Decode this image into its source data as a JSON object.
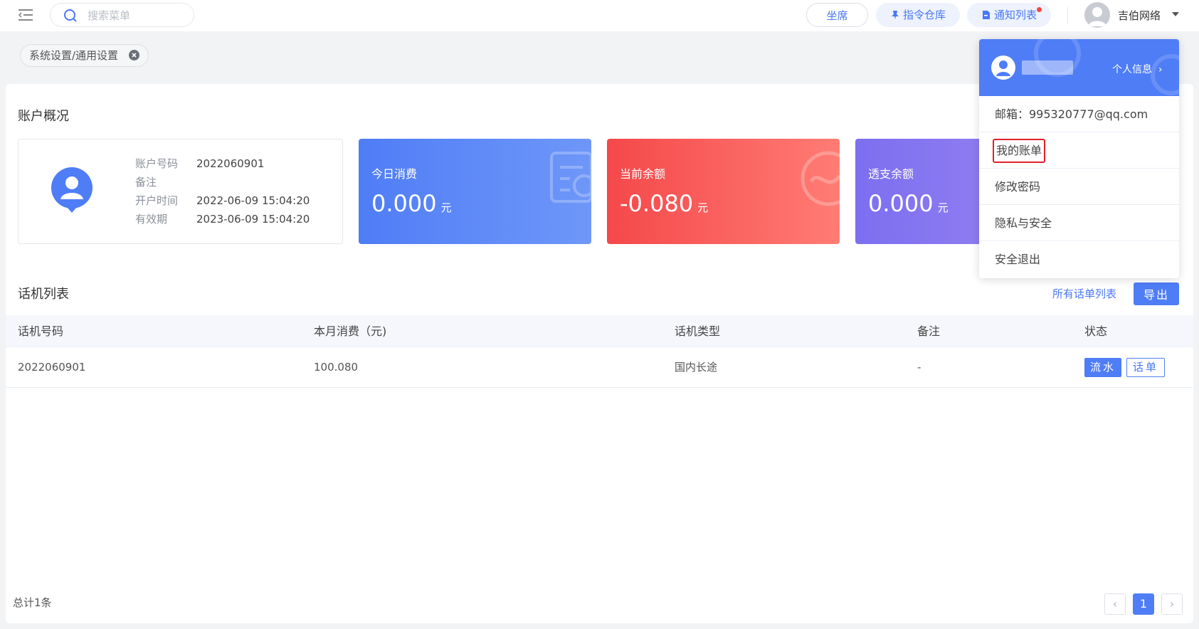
{
  "topbar": {
    "search_placeholder": "搜索菜单",
    "seat_label": "坐席",
    "command_label": "指令仓库",
    "notify_label": "通知列表",
    "user_name": "吉伯网络"
  },
  "tags": {
    "current": "系统设置/通用设置"
  },
  "account": {
    "title": "账户概况",
    "info": [
      {
        "key": "账户号码",
        "value": "2022060901"
      },
      {
        "key": "备注",
        "value": ""
      },
      {
        "key": "开户时间",
        "value": "2022-06-09 15:04:20"
      },
      {
        "key": "有效期",
        "value": "2023-06-09 15:04:20"
      }
    ],
    "cards": [
      {
        "label": "今日消费",
        "amount": "0.000",
        "unit": "元"
      },
      {
        "label": "当前余额",
        "amount": "-0.080",
        "unit": "元"
      },
      {
        "label": "透支余额",
        "amount": "0.000",
        "unit": "元"
      }
    ]
  },
  "phones": {
    "title": "话机列表",
    "all_link": "所有话单列表",
    "export_label": "导出",
    "columns": [
      "话机号码",
      "本月消费（元)",
      "话机类型",
      "备注",
      "状态"
    ],
    "rows": [
      {
        "number": "2022060901",
        "consumption": "100.080",
        "type": "国内长途",
        "note": "-",
        "flow_label": "流水",
        "bill_label": "话单"
      }
    ],
    "total": "总计1条",
    "page": "1"
  },
  "dropdown": {
    "profile_label": "个人信息",
    "email": "邮箱：995320777@qq.com",
    "bills": "我的账单",
    "change_password": "修改密码",
    "privacy": "隐私与安全",
    "logout": "安全退出"
  },
  "colors": {
    "primary": "#4f7df6",
    "danger": "#f5484a",
    "purple": "#7c6ff0",
    "highlight": "#e0202a"
  }
}
